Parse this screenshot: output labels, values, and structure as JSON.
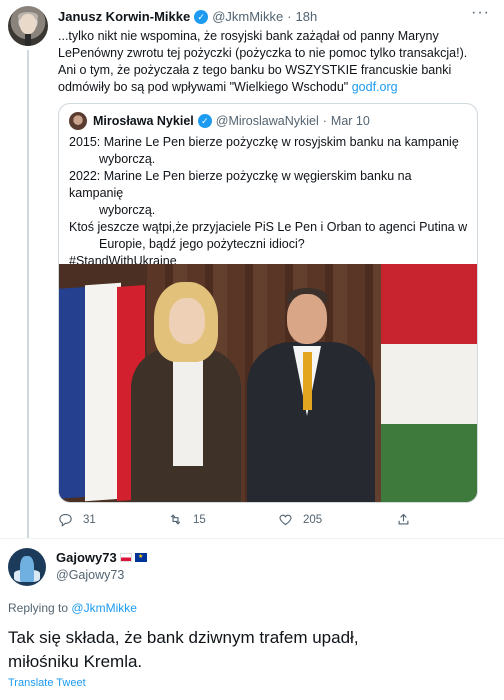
{
  "tweet1": {
    "author_name": "Janusz Korwin-Mikke",
    "handle": "@JkmMikke",
    "separator": "·",
    "time": "18h",
    "text_lines": [
      "...tylko nikt nie wspomina, że rosyjski bank zażądał od panny Maryny",
      "LePenówny zwrotu tej pożyczki (pożyczka to nie pomoc tylko transakcja!).",
      "Ani o tym, że pożyczała z tego banku bo WSZYSTKIE francuskie banki",
      "odmówiły bo są pod wpływami \"Wielkiego Wschodu\""
    ],
    "link_text": "godf.org",
    "quote": {
      "author_name": "Mirosława Nykiel",
      "handle": "@MiroslawaNykiel",
      "separator": "·",
      "time": "Mar 10",
      "lines": [
        "2015: Marine Le Pen bierze pożyczkę w rosyjskim banku na kampanię",
        "wyborczą.",
        "2022: Marine Le Pen bierze pożyczkę w węgierskim banku na kampanię",
        "wyborczą.",
        "Ktoś jeszcze wątpi,że przyjaciele PiS Le Pen i Orban to agenci Putina w",
        "Europie, bądź jego pożyteczni idioci?",
        "#StandWithUkraine"
      ]
    },
    "actions": {
      "replies": "31",
      "retweets": "15",
      "likes": "205"
    }
  },
  "tweet2": {
    "author_name": "Gajowy73",
    "handle": "@Gajowy73",
    "replying_label": "Replying to",
    "replying_to": "@JkmMikke",
    "text_line1": "Tak się składa, że bank dziwnym trafem upadł,",
    "text_line2": "miłośniku Kremla.",
    "translate": "Translate Tweet"
  },
  "colors": {
    "accent": "#1d9bf0",
    "secondary_text": "#536471",
    "border": "#cfd9de"
  }
}
